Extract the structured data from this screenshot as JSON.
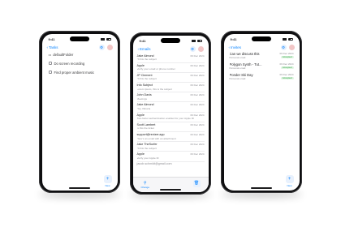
{
  "tasks_phone": {
    "status_time": "9:41",
    "back_label": "Tasks",
    "list_heading": "defaultFolder",
    "items": [
      {
        "label": "Do screen recording"
      },
      {
        "label": "Find proper ambient music"
      }
    ],
    "fab_label": "New"
  },
  "emails_phone": {
    "status_time": "9:41",
    "back_label": "Emails",
    "emails": [
      {
        "sender": "Jake Almond",
        "date": "09 Dec 2024",
        "preview": "Hi this the subject"
      },
      {
        "sender": "Apple",
        "date": "09 Dec 2024",
        "preview": "Verify your email or phone number"
      },
      {
        "sender": "JP Clement",
        "date": "09 Dec 2024",
        "preview": "Hi this the subject"
      },
      {
        "sender": "Info Subject",
        "date": "09 Dec 2024",
        "preview": "Lorem ipsum, this is the subject"
      },
      {
        "sender": "John Davis",
        "date": "09 Dec 2024",
        "preview": "Meetings"
      },
      {
        "sender": "Jake Almond",
        "date": "09 Dec 2024",
        "preview": "Hey Viktoria"
      },
      {
        "sender": "Apple",
        "date": "09 Dec 2024",
        "preview": "Two-factor authentication enabled for your Apple ID"
      },
      {
        "sender": "Scott Lambert",
        "date": "09 Dec 2024",
        "preview": "Is this the ticket"
      },
      {
        "sender": "support@revizer.app",
        "date": "09 Dec 2024",
        "preview": "Here's an email with an attachment"
      },
      {
        "sender": "Jake TheSurfer",
        "date": "09 Dec 2024",
        "preview": "Hi this the subject"
      },
      {
        "sender": "Apple",
        "date": "09 Dec 2024",
        "preview": "Verify your Apple ID"
      }
    ],
    "email_cut_off": "jacob.schmidt@gmail.com",
    "tab_left_label": "Change"
  },
  "invites_phone": {
    "status_time": "9:41",
    "back_label": "Invites",
    "invites": [
      {
        "title": "Can we discuss this",
        "sub": "Personal email",
        "date": "09 Dec 2024",
        "status": "Accepted"
      },
      {
        "title": "Polygon Synth - Tut...",
        "sub": "Personal email",
        "date": "09 Dec 2024",
        "status": "Accepted"
      },
      {
        "title": "Ponder Ski Day",
        "sub": "Personal email",
        "date": "09 Dec 2024",
        "status": "Accepted"
      }
    ],
    "fab_label": "New"
  }
}
